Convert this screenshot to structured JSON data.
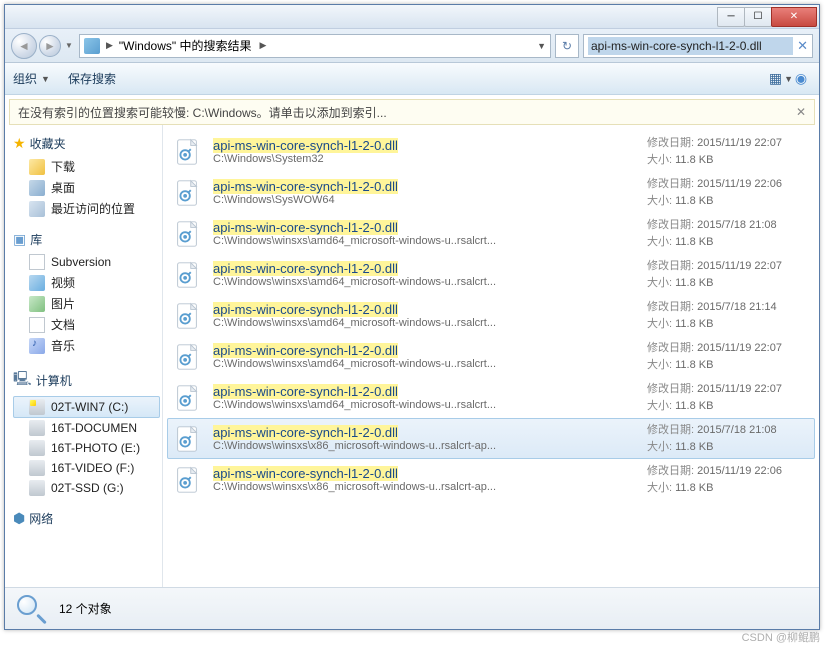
{
  "breadcrumb": {
    "current": "\"Windows\" 中的搜索结果",
    "arrow": "▶"
  },
  "search": {
    "value": "api-ms-win-core-synch-l1-2-0.dll"
  },
  "toolbar": {
    "organize": "组织",
    "savesearch": "保存搜索"
  },
  "banner": {
    "text": "在没有索引的位置搜索可能较慢: C:\\Windows。请单击以添加到索引..."
  },
  "sidebar": {
    "favorites": {
      "head": "收藏夹",
      "items": [
        "下载",
        "桌面",
        "最近访问的位置"
      ]
    },
    "libs": {
      "head": "库",
      "items": [
        "Subversion",
        "视频",
        "图片",
        "文档",
        "音乐"
      ]
    },
    "computer": {
      "head": "计算机",
      "items": [
        "02T-WIN7 (C:)",
        "16T-DOCUMEN",
        "16T-PHOTO (E:)",
        "16T-VIDEO (F:)",
        "02T-SSD (G:)"
      ]
    },
    "network": {
      "head": "网络"
    }
  },
  "results": [
    {
      "title": "api-ms-win-core-synch-l1-2-0.dll",
      "path": "C:\\Windows\\System32",
      "date": "2015/11/19 22:07",
      "size": "11.8 KB",
      "sel": false
    },
    {
      "title": "api-ms-win-core-synch-l1-2-0.dll",
      "path": "C:\\Windows\\SysWOW64",
      "date": "2015/11/19 22:06",
      "size": "11.8 KB",
      "sel": false
    },
    {
      "title": "api-ms-win-core-synch-l1-2-0.dll",
      "path": "C:\\Windows\\winsxs\\amd64_microsoft-windows-u..rsalcrt...",
      "date": "2015/7/18 21:08",
      "size": "11.8 KB",
      "sel": false
    },
    {
      "title": "api-ms-win-core-synch-l1-2-0.dll",
      "path": "C:\\Windows\\winsxs\\amd64_microsoft-windows-u..rsalcrt...",
      "date": "2015/11/19 22:07",
      "size": "11.8 KB",
      "sel": false
    },
    {
      "title": "api-ms-win-core-synch-l1-2-0.dll",
      "path": "C:\\Windows\\winsxs\\amd64_microsoft-windows-u..rsalcrt...",
      "date": "2015/7/18 21:14",
      "size": "11.8 KB",
      "sel": false
    },
    {
      "title": "api-ms-win-core-synch-l1-2-0.dll",
      "path": "C:\\Windows\\winsxs\\amd64_microsoft-windows-u..rsalcrt...",
      "date": "2015/11/19 22:07",
      "size": "11.8 KB",
      "sel": false
    },
    {
      "title": "api-ms-win-core-synch-l1-2-0.dll",
      "path": "C:\\Windows\\winsxs\\amd64_microsoft-windows-u..rsalcrt...",
      "date": "2015/11/19 22:07",
      "size": "11.8 KB",
      "sel": false
    },
    {
      "title": "api-ms-win-core-synch-l1-2-0.dll",
      "path": "C:\\Windows\\winsxs\\x86_microsoft-windows-u..rsalcrt-ap...",
      "date": "2015/7/18 21:08",
      "size": "11.8 KB",
      "sel": true
    },
    {
      "title": "api-ms-win-core-synch-l1-2-0.dll",
      "path": "C:\\Windows\\winsxs\\x86_microsoft-windows-u..rsalcrt-ap...",
      "date": "2015/11/19 22:06",
      "size": "11.8 KB",
      "sel": false
    }
  ],
  "meta_labels": {
    "date": "修改日期:",
    "size": "大小:"
  },
  "status": {
    "count": "12 个对象"
  },
  "watermark": "CSDN @柳鲲鹏"
}
